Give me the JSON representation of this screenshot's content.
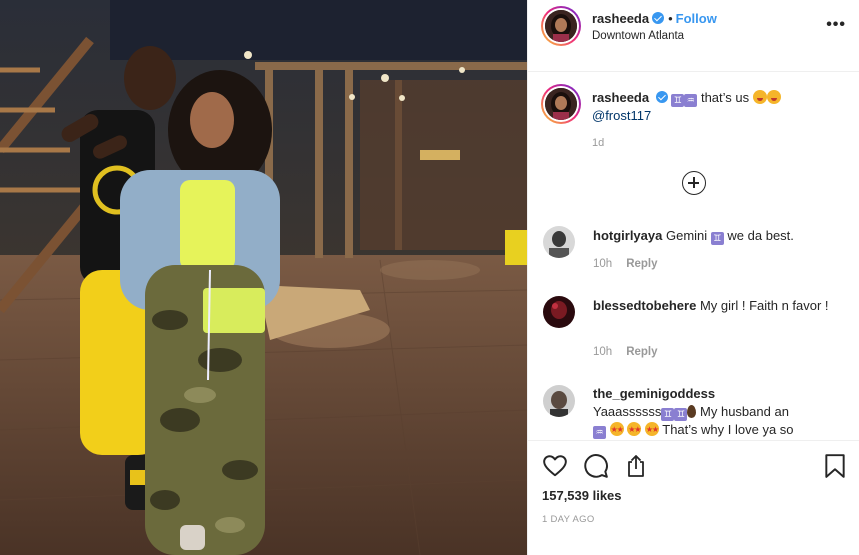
{
  "post": {
    "username": "rasheeda",
    "follow_label": "Follow",
    "dot": "•",
    "location": "Downtown Atlanta",
    "more_label": "•••",
    "caption": {
      "username": "rasheeda",
      "text": "that’s us",
      "mention": "@frost117",
      "time": "1d"
    },
    "comments": [
      {
        "username": "hotgirlyaya",
        "text_before": "Gemini",
        "text_after": "we da best.",
        "time": "10h",
        "reply": "Reply"
      },
      {
        "username": "blessedtobehere",
        "text": "My girl ! Faith n favor !",
        "time": "10h",
        "reply": "Reply"
      },
      {
        "username": "the_geminigoddess",
        "text_line1": "Yaaassssss",
        "text_line2": "My husband an",
        "text_line3": "That’s why I love ya so"
      }
    ],
    "likes": "157,539 likes",
    "posted_ago": "1 DAY AGO"
  },
  "icons": {
    "verified": "verified-badge-icon",
    "gemini": "♊",
    "aquarius": "♒",
    "more": "more-options-icon",
    "load_more": "plus-circle-icon",
    "like": "heart-icon",
    "comment": "comment-bubble-icon",
    "share": "share-icon",
    "save": "bookmark-icon"
  },
  "colors": {
    "accent": "#3897f0",
    "text": "#262626",
    "muted": "#999999",
    "border": "#efefef"
  }
}
